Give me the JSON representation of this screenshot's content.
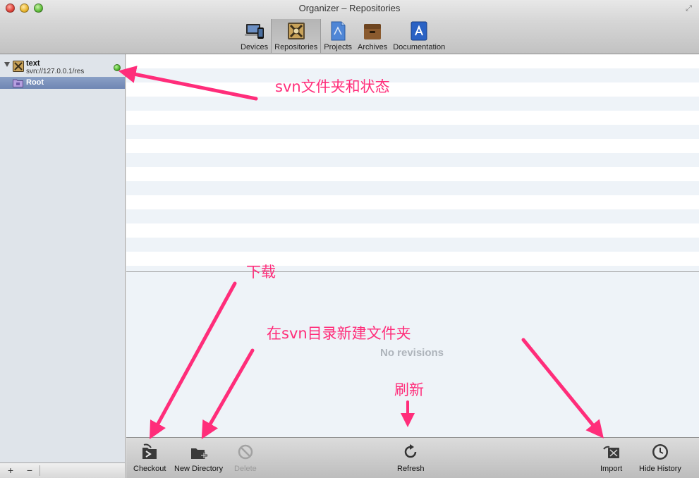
{
  "window": {
    "title": "Organizer – Repositories"
  },
  "toolbar": {
    "items": [
      {
        "label": "Devices"
      },
      {
        "label": "Repositories"
      },
      {
        "label": "Projects"
      },
      {
        "label": "Archives"
      },
      {
        "label": "Documentation"
      }
    ],
    "selected": "Repositories"
  },
  "sidebar": {
    "repo": {
      "name": "text",
      "url": "svn://127.0.0.1/res",
      "status_color": "#4fb52c"
    },
    "root_label": "Root",
    "add_label": "+",
    "remove_label": "−"
  },
  "revisions": {
    "empty_text": "No revisions"
  },
  "bottombar": {
    "checkout": "Checkout",
    "new_directory": "New Directory",
    "delete": "Delete",
    "refresh": "Refresh",
    "import": "Import",
    "hide_history": "Hide History"
  },
  "annotations": {
    "color": "#ff2d7a",
    "svn_folder_status": "svn文件夹和状态",
    "download": "下载",
    "new_folder": "在svn目录新建文件夹",
    "refresh": "刷新"
  }
}
